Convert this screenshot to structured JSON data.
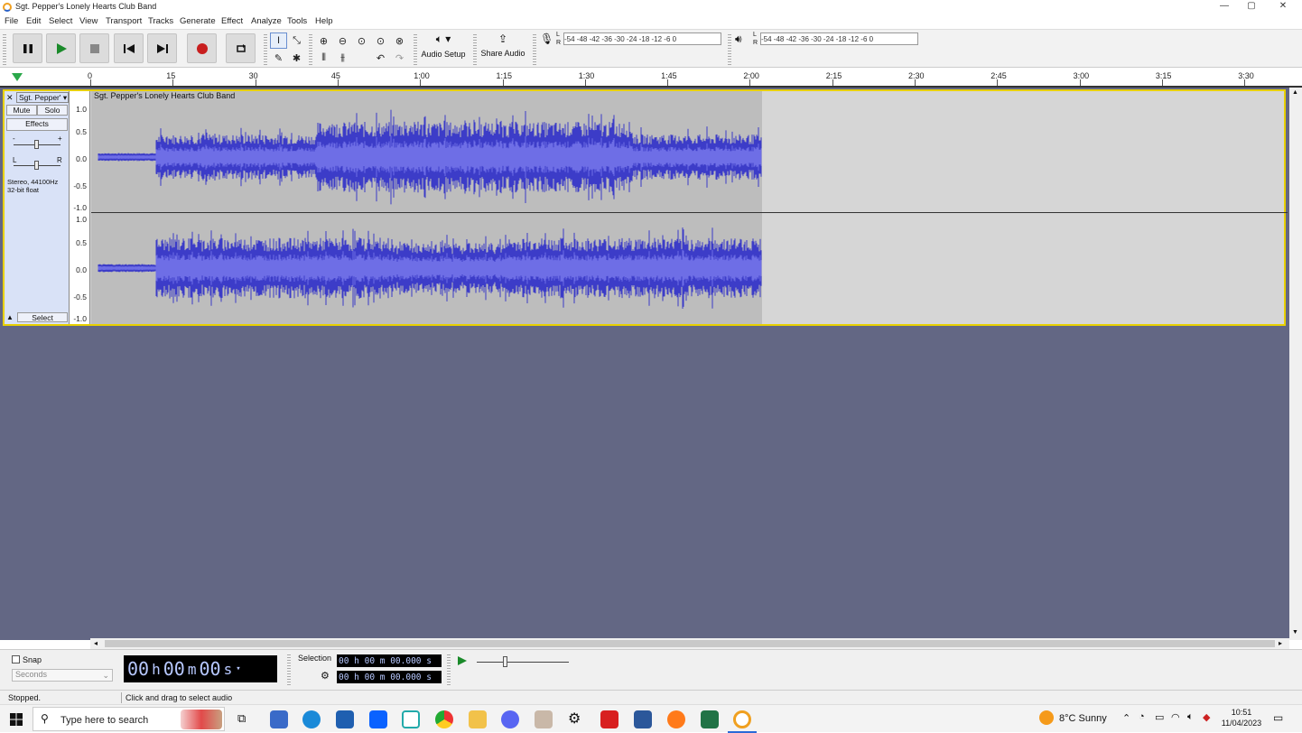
{
  "window": {
    "title": "Sgt. Pepper's Lonely Hearts Club Band",
    "min": "—",
    "max": "▢",
    "close": "✕"
  },
  "menu": [
    "File",
    "Edit",
    "Select",
    "View",
    "Transport",
    "Tracks",
    "Generate",
    "Effect",
    "Analyze",
    "Tools",
    "Help"
  ],
  "toolbar": {
    "audio_setup": "Audio Setup",
    "share_audio": "Share Audio",
    "rec_meter": "-54 -48 -42 -36 -30 -24 -18 -12 -6 0",
    "play_meter": "-54 -48 -42 -36 -30 -24 -18 -12 -6 0",
    "meter_l": "L",
    "meter_r": "R"
  },
  "ruler": {
    "ticks": [
      "0",
      "15",
      "30",
      "45",
      "1:00",
      "1:15",
      "1:30",
      "1:45",
      "2:00",
      "2:15",
      "2:30",
      "2:45",
      "3:00",
      "3:15",
      "3:30"
    ]
  },
  "track": {
    "name": "Sgt. Pepper'",
    "clip_name": "Sgt. Pepper's Lonely Hearts Club Band",
    "mute": "Mute",
    "solo": "Solo",
    "effects": "Effects",
    "gain_minus": "-",
    "gain_plus": "+",
    "pan_l": "L",
    "pan_r": "R",
    "info_line1": "Stereo, 44100Hz",
    "info_line2": "32-bit float",
    "select": "Select",
    "vscale": [
      "1.0",
      "0.5",
      "0.0",
      "-0.5",
      "-1.0"
    ]
  },
  "bottom": {
    "snap": "Snap",
    "seconds": "Seconds",
    "time": [
      "00",
      "h",
      "00",
      "m",
      "00",
      "s"
    ],
    "selection_label": "Selection",
    "sel_start": "00 h 00 m 00.000 s",
    "sel_end": "00 h 00 m 00.000 s"
  },
  "status": {
    "left": "Stopped.",
    "right": "Click and drag to select audio"
  },
  "taskbar": {
    "search_placeholder": "Type here to search",
    "weather": "8°C  Sunny",
    "time": "10:51",
    "date": "11/04/2023"
  },
  "colors": {
    "waveform": "#3c3cc8",
    "waveform_rms": "#6e6ee6",
    "clip_bg": "#bdbdbd",
    "track_bg": "#636784",
    "selected_border": "#e8d000"
  }
}
